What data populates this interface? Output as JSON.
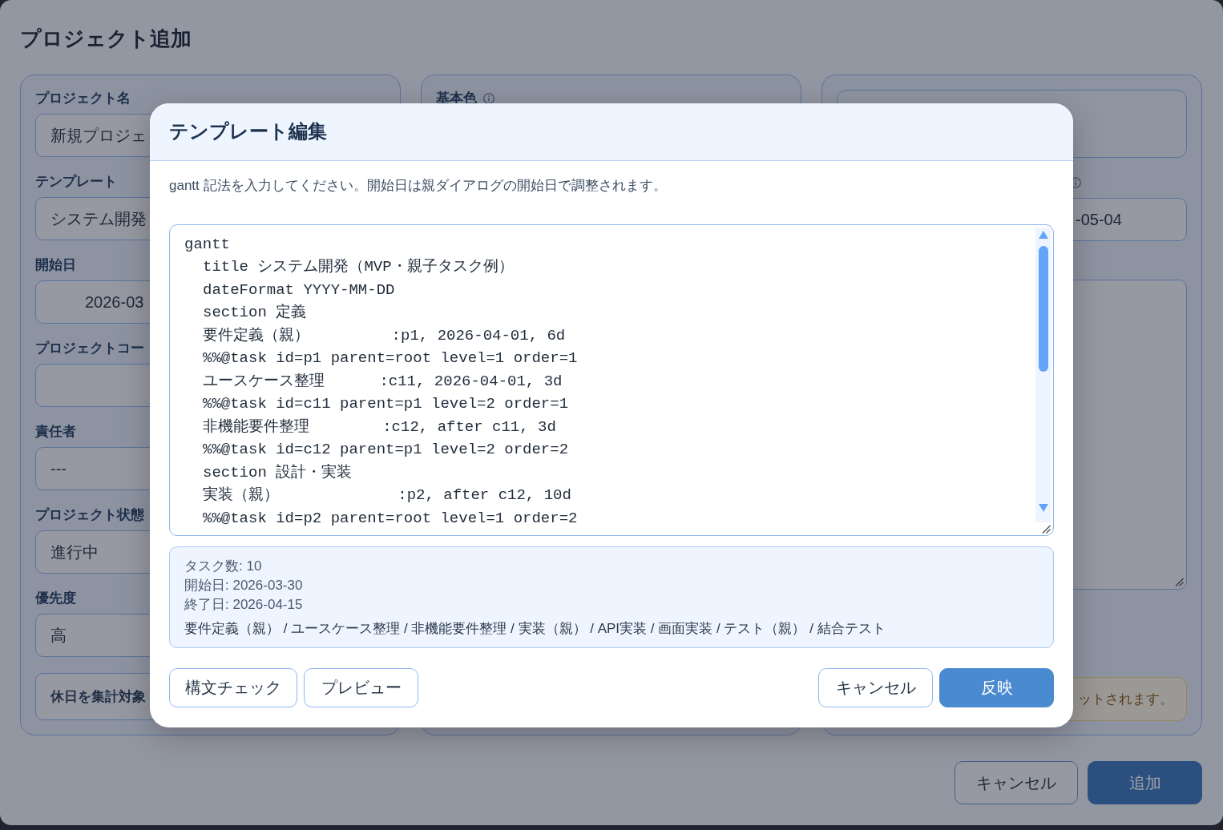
{
  "page": {
    "title": "プロジェクト追加"
  },
  "columns": [
    {
      "fields": [
        {
          "kind": "input",
          "label": "プロジェクト名",
          "value": "新規プロジェ"
        },
        {
          "kind": "input",
          "label": "テンプレート",
          "value": "システム開発"
        },
        {
          "kind": "date",
          "label": "開始日",
          "value": "2026-03"
        },
        {
          "kind": "input",
          "label": "プロジェクトコー"
        },
        {
          "kind": "input",
          "label": "責任者",
          "value": "---"
        },
        {
          "kind": "input",
          "label": "プロジェクト状態",
          "value": "進行中"
        },
        {
          "kind": "input",
          "label": "優先度",
          "value": "高"
        },
        {
          "kind": "option",
          "label": "休日を集計対象"
        }
      ]
    },
    {
      "fields": [
        {
          "kind": "label",
          "label": "基本色",
          "info": true
        }
      ]
    },
    {
      "fields": [
        {
          "kind": "box"
        },
        {
          "kind": "date",
          "info": true,
          "value": "-05-04"
        },
        {
          "kind": "textarea"
        },
        {
          "kind": "alert",
          "text": "ットされます。"
        }
      ]
    }
  ],
  "actions": [
    {
      "label": "キャンセル",
      "primary": false
    },
    {
      "label": "追加",
      "primary": true
    }
  ],
  "dialog": {
    "title": "テンプレート編集",
    "description": "gantt 記法を入力してください。開始日は親ダイアログの開始日で調整されます。",
    "editor": {
      "lines": [
        {
          "text": "gantt",
          "children": [
            {
              "text": "title システム開発（MVP・親子タスク例）"
            },
            {
              "text": "dateFormat YYYY-MM-DD"
            },
            {
              "text": "section 定義"
            },
            {
              "text": "要件定義（親）         :p1, 2026-04-01, 6d"
            },
            {
              "text": "%%@task id=p1 parent=root level=1 order=1"
            },
            {
              "text": "ユースケース整理      :c11, 2026-04-01, 3d"
            },
            {
              "text": "%%@task id=c11 parent=p1 level=2 order=1"
            },
            {
              "text": "非機能要件整理        :c12, after c11, 3d"
            },
            {
              "text": "%%@task id=c12 parent=p1 level=2 order=2"
            },
            {
              "text": "section 設計・実装"
            },
            {
              "text": "実装（親）             :p2, after c12, 10d"
            },
            {
              "text": "%%@task id=p2 parent=root level=1 order=2"
            }
          ]
        }
      ]
    },
    "summary": {
      "lines": [
        "タスク数: 10",
        "開始日: 2026-03-30",
        "終了日: 2026-04-15"
      ],
      "task_path": "要件定義（親） / ユースケース整理 / 非機能要件整理 / 実装（親） / API実装 / 画面実装 / テスト（親） / 結合テスト"
    },
    "actions_left": [
      {
        "label": "構文チェック",
        "primary": false
      },
      {
        "label": "プレビュー",
        "primary": false
      }
    ],
    "actions_right": [
      {
        "label": "キャンセル",
        "primary": false
      },
      {
        "label": "反映",
        "primary": true
      }
    ]
  }
}
